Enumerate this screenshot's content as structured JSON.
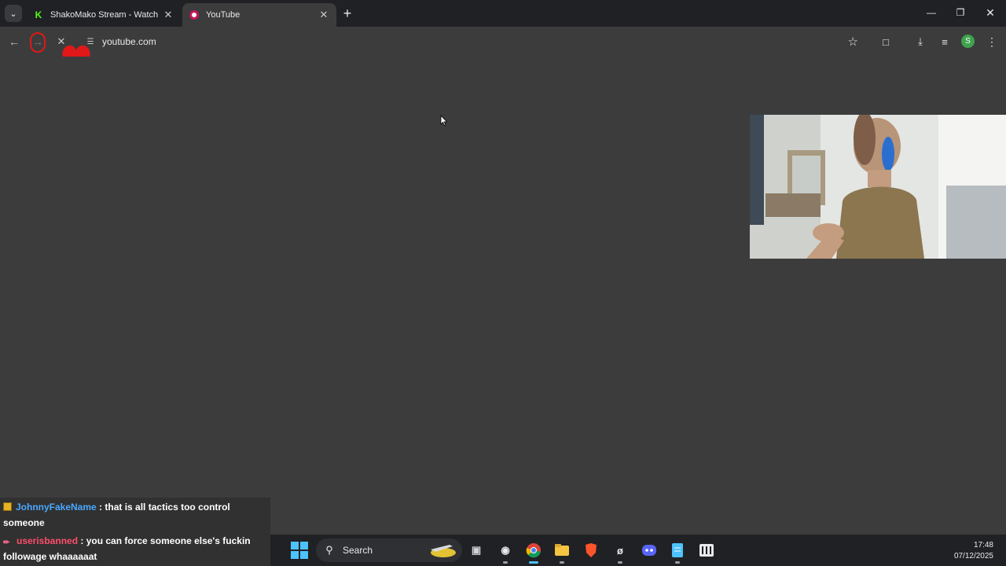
{
  "browser": {
    "tabs": [
      {
        "title": "ShakoMako Stream - Watch Live",
        "favicon": "kick-icon",
        "active": false
      },
      {
        "title": "YouTube",
        "favicon": "youtube-icon",
        "active": true
      }
    ],
    "address_bar": {
      "url": "youtube.com"
    },
    "profile_initial": "S",
    "accent_color": "#3fa34d"
  },
  "chat": {
    "messages": [
      {
        "username": "JohnnyFakeName",
        "separator": " : ",
        "text": "that is all tactics too control someone",
        "badge": "crown-icon",
        "username_color": "#4aa8ff"
      },
      {
        "username": "userisbanned",
        "separator": " : ",
        "text": "you can force someone else's fuckin followage whaaaaaat",
        "badge": "sword-icon",
        "username_color": "#ff4d6a"
      }
    ]
  },
  "taskbar": {
    "search_label": "Search",
    "time": "17:48",
    "date": "07/12/2025"
  }
}
